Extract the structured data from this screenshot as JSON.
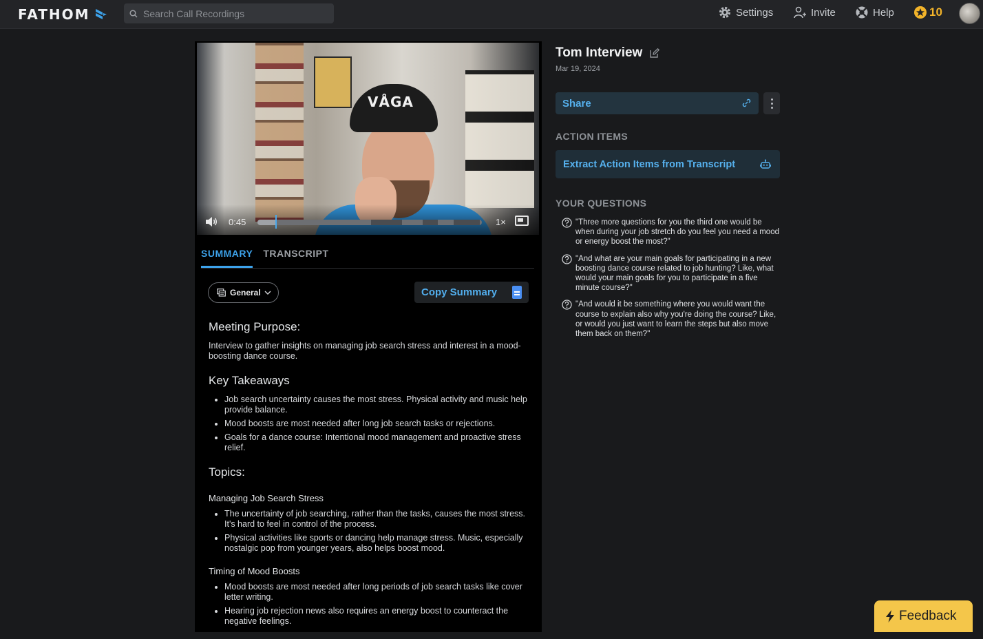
{
  "app": {
    "logo": "FATHOM",
    "search_placeholder": "Search Call Recordings",
    "nav": {
      "settings": "Settings",
      "invite": "Invite",
      "help": "Help"
    },
    "points": "10",
    "accent_color": "#3da2ea"
  },
  "video": {
    "cap_text": "VÅGA",
    "time": "0:45",
    "speed": "1×",
    "progress": 0.08
  },
  "tabs": [
    {
      "label": "SUMMARY",
      "active": true
    },
    {
      "label": "TRANSCRIPT",
      "active": false
    }
  ],
  "summary": {
    "template_label": "General",
    "copy_label": "Copy Summary",
    "meeting_purpose_heading": "Meeting Purpose:",
    "meeting_purpose_text": "Interview to gather insights on managing job search stress and interest in a mood-boosting dance course.",
    "takeaways_heading": "Key Takeaways",
    "takeaways": [
      "Job search uncertainty causes the most stress. Physical activity and music help provide balance.",
      "Mood boosts are most needed after long job search tasks or rejections.",
      "Goals for a dance course: Intentional mood management and proactive stress relief."
    ],
    "topics_heading": "Topics:",
    "topics": [
      {
        "title": "Managing Job Search Stress",
        "points": [
          "The uncertainty of job searching, rather than the tasks, causes the most stress. It's hard to feel in control of the process.",
          "Physical activities like sports or dancing help manage stress. Music, especially nostalgic pop from younger years, also helps boost mood."
        ]
      },
      {
        "title": "Timing of Mood Boosts",
        "points": [
          "Mood boosts are most needed after long periods of job search tasks like cover letter writing.",
          "Hearing job rejection news also requires an energy boost to counteract the negative feelings."
        ]
      }
    ]
  },
  "meeting": {
    "title": "Tom Interview",
    "date": "Mar 19, 2024",
    "share_label": "Share",
    "action_items_label": "ACTION ITEMS",
    "extract_label": "Extract Action Items from Transcript",
    "questions_label": "YOUR QUESTIONS",
    "questions": [
      "\"Three more questions for you the third one would be when during your job stretch do you feel you need a mood or energy boost the most?\"",
      "\"And what are your main goals for participating in a new boosting dance course related to job hunting? Like, what would your main goals for you to participate in a five minute course?\"",
      "\"And would it be something where you would want the course to explain also why you're doing the course? Like, or would you just want to learn the steps but also move them back on them?\""
    ]
  },
  "feedback_label": "Feedback"
}
